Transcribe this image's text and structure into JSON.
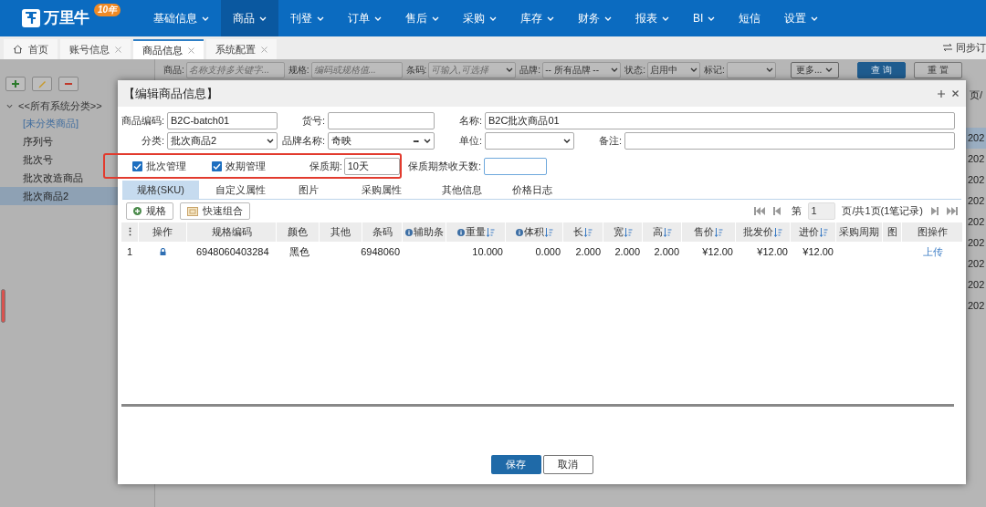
{
  "nav": {
    "logo": "万里牛",
    "badge": "10年",
    "items": [
      {
        "label": "基础信息",
        "selected": false,
        "has_menu": true
      },
      {
        "label": "商品",
        "selected": true,
        "has_menu": true
      },
      {
        "label": "刊登",
        "selected": false,
        "has_menu": true
      },
      {
        "label": "订单",
        "selected": false,
        "has_menu": true
      },
      {
        "label": "售后",
        "selected": false,
        "has_menu": true
      },
      {
        "label": "采购",
        "selected": false,
        "has_menu": true
      },
      {
        "label": "库存",
        "selected": false,
        "has_menu": true
      },
      {
        "label": "财务",
        "selected": false,
        "has_menu": true
      },
      {
        "label": "报表",
        "selected": false,
        "has_menu": true
      },
      {
        "label": "BI",
        "selected": false,
        "has_menu": true
      },
      {
        "label": "短信",
        "selected": false,
        "has_menu": false
      },
      {
        "label": "设置",
        "selected": false,
        "has_menu": true
      }
    ]
  },
  "page_tabs": [
    {
      "label": "首页",
      "selected": false,
      "kind": "home"
    },
    {
      "label": "账号信息",
      "selected": false,
      "kind": "closable"
    },
    {
      "label": "商品信息",
      "selected": true,
      "kind": "closable"
    },
    {
      "label": "系统配置",
      "selected": false,
      "kind": "closable"
    }
  ],
  "sync_link": "同步订",
  "filter_bar": {
    "fields": [
      {
        "label": "商品:",
        "placeholder": "名称支持多关键字...",
        "kind": "input"
      },
      {
        "label": "规格:",
        "placeholder": "编码或规格值...",
        "kind": "input"
      },
      {
        "label": "条码:",
        "placeholder": "可输入,可选择",
        "kind": "combo"
      },
      {
        "label": "品牌:",
        "value": "-- 所有品牌 --",
        "kind": "select"
      },
      {
        "label": "状态:",
        "value": "启用中",
        "kind": "select"
      },
      {
        "label": "标记:",
        "kind": "select"
      }
    ],
    "buttons": [
      {
        "label": "更多...",
        "kind": "dropdown"
      },
      {
        "label": "查 询",
        "kind": "primary"
      },
      {
        "label": "重 置",
        "kind": "default"
      }
    ]
  },
  "sidebar": {
    "tree": {
      "label": "<<所有系统分类>>",
      "expanded": true,
      "children": [
        {
          "label": "[未分类商品]",
          "selected": false,
          "kind": "link"
        },
        {
          "label": "序列号",
          "selected": false,
          "kind": "item"
        },
        {
          "label": "批次号",
          "selected": false,
          "kind": "item"
        },
        {
          "label": "批次改造商品",
          "selected": false,
          "kind": "item"
        },
        {
          "label": "批次商品2",
          "selected": true,
          "kind": "item"
        }
      ]
    }
  },
  "background_table": {
    "pager_text": "页/",
    "rows": [
      {
        "cell": "202",
        "selected": true
      },
      {
        "cell": "202",
        "selected": false
      },
      {
        "cell": "202",
        "selected": false
      },
      {
        "cell": "202",
        "selected": false
      },
      {
        "cell": "202",
        "selected": false
      },
      {
        "cell": "202",
        "selected": false
      },
      {
        "cell": "202",
        "selected": false
      },
      {
        "cell": "202",
        "selected": false
      },
      {
        "cell": "202",
        "selected": false
      }
    ]
  },
  "dialog": {
    "title": "【编辑商品信息】",
    "form_rows": [
      [
        {
          "label": "商品编码:",
          "value": "B2C-batch01",
          "kind": "input"
        },
        {
          "label": "货号:",
          "kind": "input"
        },
        {
          "label": "名称:",
          "value": "B2C批次商品01",
          "kind": "input"
        }
      ],
      [
        {
          "label": "分类:",
          "value": "批次商品2",
          "kind": "select"
        },
        {
          "label": "品牌名称:",
          "value": "奇映",
          "kind": "brand",
          "more_text": "•••"
        },
        {
          "label": "单位:",
          "kind": "select"
        },
        {
          "label": "备注:",
          "kind": "input"
        }
      ]
    ],
    "batch_row": {
      "highlighted": true,
      "checks": [
        {
          "label": "批次管理",
          "checked": true
        },
        {
          "label": "效期管理",
          "checked": true
        }
      ],
      "shelf_life": {
        "label": "保质期:",
        "value": "10天"
      },
      "reject_days": {
        "label": "保质期禁收天数:",
        "focused": true
      }
    },
    "tabs": [
      {
        "label": "规格(SKU)",
        "selected": true
      },
      {
        "label": "自定义属性",
        "selected": false
      },
      {
        "label": "图片",
        "selected": false
      },
      {
        "label": "采购属性",
        "selected": false
      },
      {
        "label": "其他信息",
        "selected": false
      },
      {
        "label": "价格日志",
        "selected": false
      }
    ],
    "toolbar": [
      {
        "label": "规格",
        "kind": "add"
      },
      {
        "label": "快速组合",
        "kind": "combine"
      }
    ],
    "pager": {
      "prefix": "第",
      "page": "1",
      "suffix": "页/共1页(1笔记录)"
    },
    "table": {
      "columns": [
        {
          "label": "⋮",
          "info": false,
          "sortable": false
        },
        {
          "label": "操作",
          "info": false,
          "sortable": false
        },
        {
          "label": "规格编码",
          "info": false,
          "sortable": false
        },
        {
          "label": "颜色",
          "info": false,
          "sortable": false
        },
        {
          "label": "其他",
          "info": false,
          "sortable": false
        },
        {
          "label": "条码",
          "info": false,
          "sortable": false
        },
        {
          "label": "辅助条",
          "info": true,
          "sortable": false
        },
        {
          "label": "重量",
          "info": true,
          "sortable": true
        },
        {
          "label": "体积",
          "info": true,
          "sortable": true
        },
        {
          "label": "长",
          "info": false,
          "sortable": true
        },
        {
          "label": "宽",
          "info": false,
          "sortable": true
        },
        {
          "label": "高",
          "info": false,
          "sortable": true
        },
        {
          "label": "售价",
          "info": false,
          "sortable": true
        },
        {
          "label": "批发价",
          "info": false,
          "sortable": true
        },
        {
          "label": "进价",
          "info": false,
          "sortable": true
        },
        {
          "label": "采购周期",
          "info": false,
          "sortable": false
        },
        {
          "label": "图",
          "info": false,
          "sortable": false
        },
        {
          "label": "图操作",
          "info": false,
          "sortable": false
        }
      ],
      "rows": [
        {
          "cells": [
            {
              "kind": "text",
              "text": "1"
            },
            {
              "kind": "lock"
            },
            {
              "kind": "text",
              "text": "6948060403284"
            },
            {
              "kind": "text",
              "text": "黑色"
            },
            {
              "kind": "empty"
            },
            {
              "kind": "text",
              "text": "6948060"
            },
            {
              "kind": "empty"
            },
            {
              "kind": "text",
              "text": "10.000"
            },
            {
              "kind": "text",
              "text": "0.000"
            },
            {
              "kind": "text",
              "text": "2.000"
            },
            {
              "kind": "text",
              "text": "2.000"
            },
            {
              "kind": "text",
              "text": "2.000"
            },
            {
              "kind": "text",
              "text": "¥12.00"
            },
            {
              "kind": "text",
              "text": "¥12.00"
            },
            {
              "kind": "text",
              "text": "¥12.00"
            },
            {
              "kind": "empty"
            },
            {
              "kind": "empty"
            },
            {
              "kind": "link",
              "text": "上传"
            }
          ]
        }
      ]
    },
    "buttons": [
      {
        "label": "保存",
        "kind": "primary"
      },
      {
        "label": "取消",
        "kind": "default"
      }
    ]
  }
}
